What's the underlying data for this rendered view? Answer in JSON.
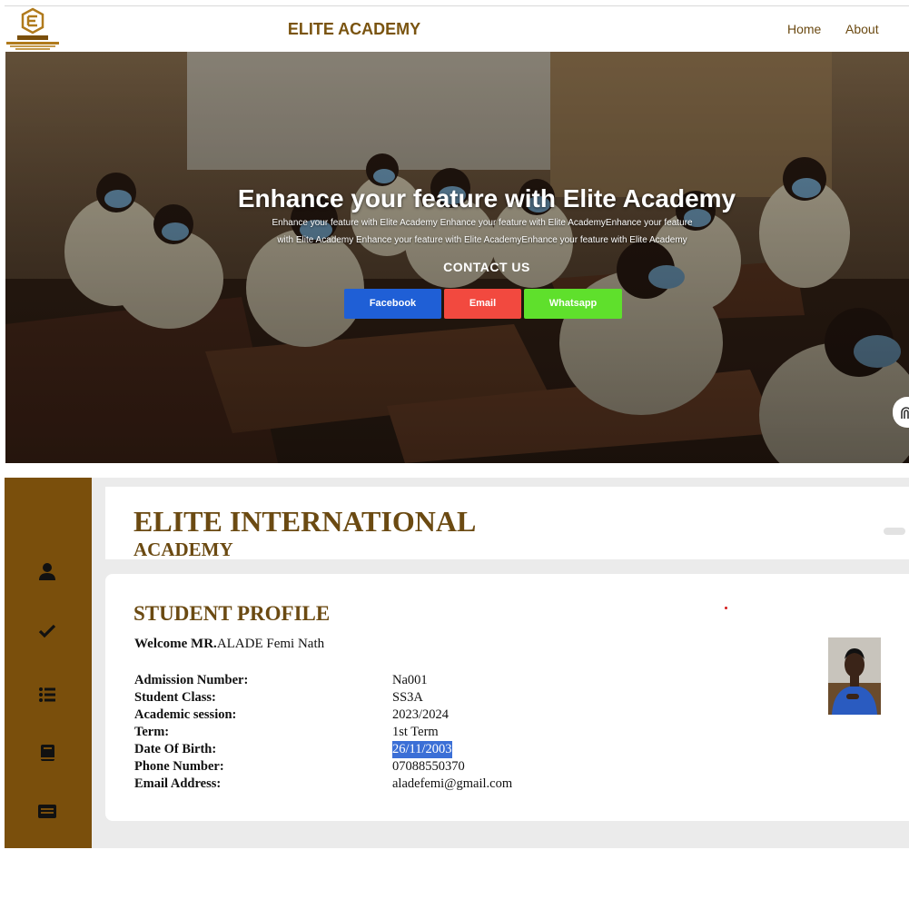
{
  "navbar": {
    "brand": "ELITE ACADEMY",
    "links": [
      "Home",
      "About"
    ],
    "logo_icon": "elite-tech-logo"
  },
  "hero": {
    "title": "Enhance your feature with Elite Academy",
    "subtitle_line1": "Enhance your feature with Elite Academy Enhance your feature with Elite AcademyEnhance your feature",
    "subtitle_line2": "with Elite Academy Enhance your feature with Elite AcademyEnhance your feature with Elite Academy",
    "contact_heading": "CONTACT US",
    "buttons": [
      {
        "label": "Facebook",
        "color": "#1f5fd6"
      },
      {
        "label": "Email",
        "color": "#f2493f"
      },
      {
        "label": "Whatsapp",
        "color": "#5fe02c"
      }
    ]
  },
  "sidebar": {
    "color": "#7a4f0c",
    "icons": [
      "user-icon",
      "check-icon",
      "list-icon",
      "book-icon",
      "id-card-icon"
    ]
  },
  "school": {
    "name": "ELITE INTERNATIONAL",
    "subname": "ACADEMY"
  },
  "profile": {
    "title": "STUDENT PROFILE",
    "welcome_prefix": "Welcome MR.",
    "student_name": "ALADE Femi Nath",
    "fields": [
      {
        "label": "Admission Number:",
        "value": "Na001"
      },
      {
        "label": "Student Class:",
        "value": "SS3A"
      },
      {
        "label": "Academic session:",
        "value": "2023/2024"
      },
      {
        "label": "Term:",
        "value": "1st Term"
      },
      {
        "label": "Date Of Birth:",
        "value": "26/11/2003"
      },
      {
        "label": "Phone Number:",
        "value": "07088550370"
      },
      {
        "label": "Email Address:",
        "value": "aladefemi@gmail.com"
      }
    ]
  },
  "colors": {
    "brand_brown": "#6b4a12",
    "selection_highlight": "#3b6fd6"
  }
}
